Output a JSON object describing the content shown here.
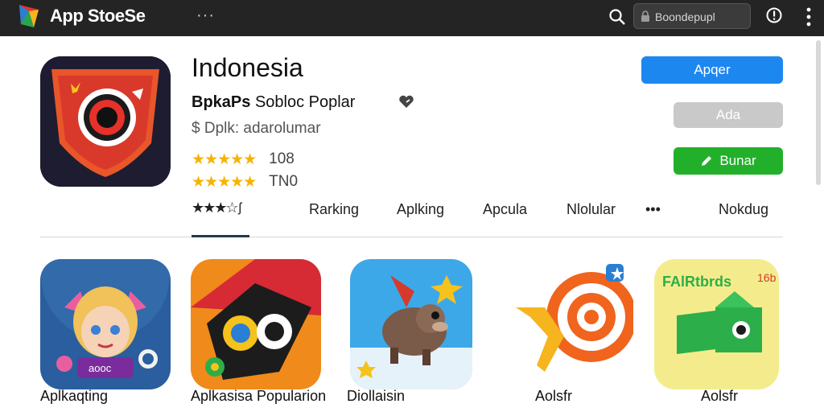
{
  "header": {
    "brand": "App StoeSe",
    "menu_dots": "···",
    "search_placeholder": "Boondepupl"
  },
  "app": {
    "title": "Indonesia",
    "developer": "BpkaPs",
    "subtitle_rest": "Sobloc Poplar",
    "price_line": "$ Dplk: adarolumar",
    "rating_rows": [
      {
        "stars": "★★★★★",
        "count": "108"
      },
      {
        "stars": "★★★★★",
        "count": "TN0"
      }
    ]
  },
  "actions": {
    "primary_label": "Apqer",
    "secondary_label": "Ada",
    "tertiary_label": "Bunar"
  },
  "tabs": {
    "rating_stars": "★★★☆",
    "items": [
      "Rarking",
      "Aplking",
      "Apcula",
      "Nlolular",
      "•••",
      "Nokdug"
    ]
  },
  "grid": [
    {
      "label": "Aplkaqting"
    },
    {
      "label": "Aplkasisa Popularion"
    },
    {
      "label": "Diollaisin"
    },
    {
      "label": "Aolsfr"
    }
  ],
  "grid_icon_texts": {
    "badge_left": "aooc",
    "tile4_title": "FAlRtbrds",
    "tile4_badge": "16b"
  },
  "colors": {
    "topbar": "#242424",
    "primary_button": "#1d87f0",
    "secondary_button": "#c9c9c9",
    "tertiary_button": "#22b02b",
    "star": "#f5b400"
  }
}
